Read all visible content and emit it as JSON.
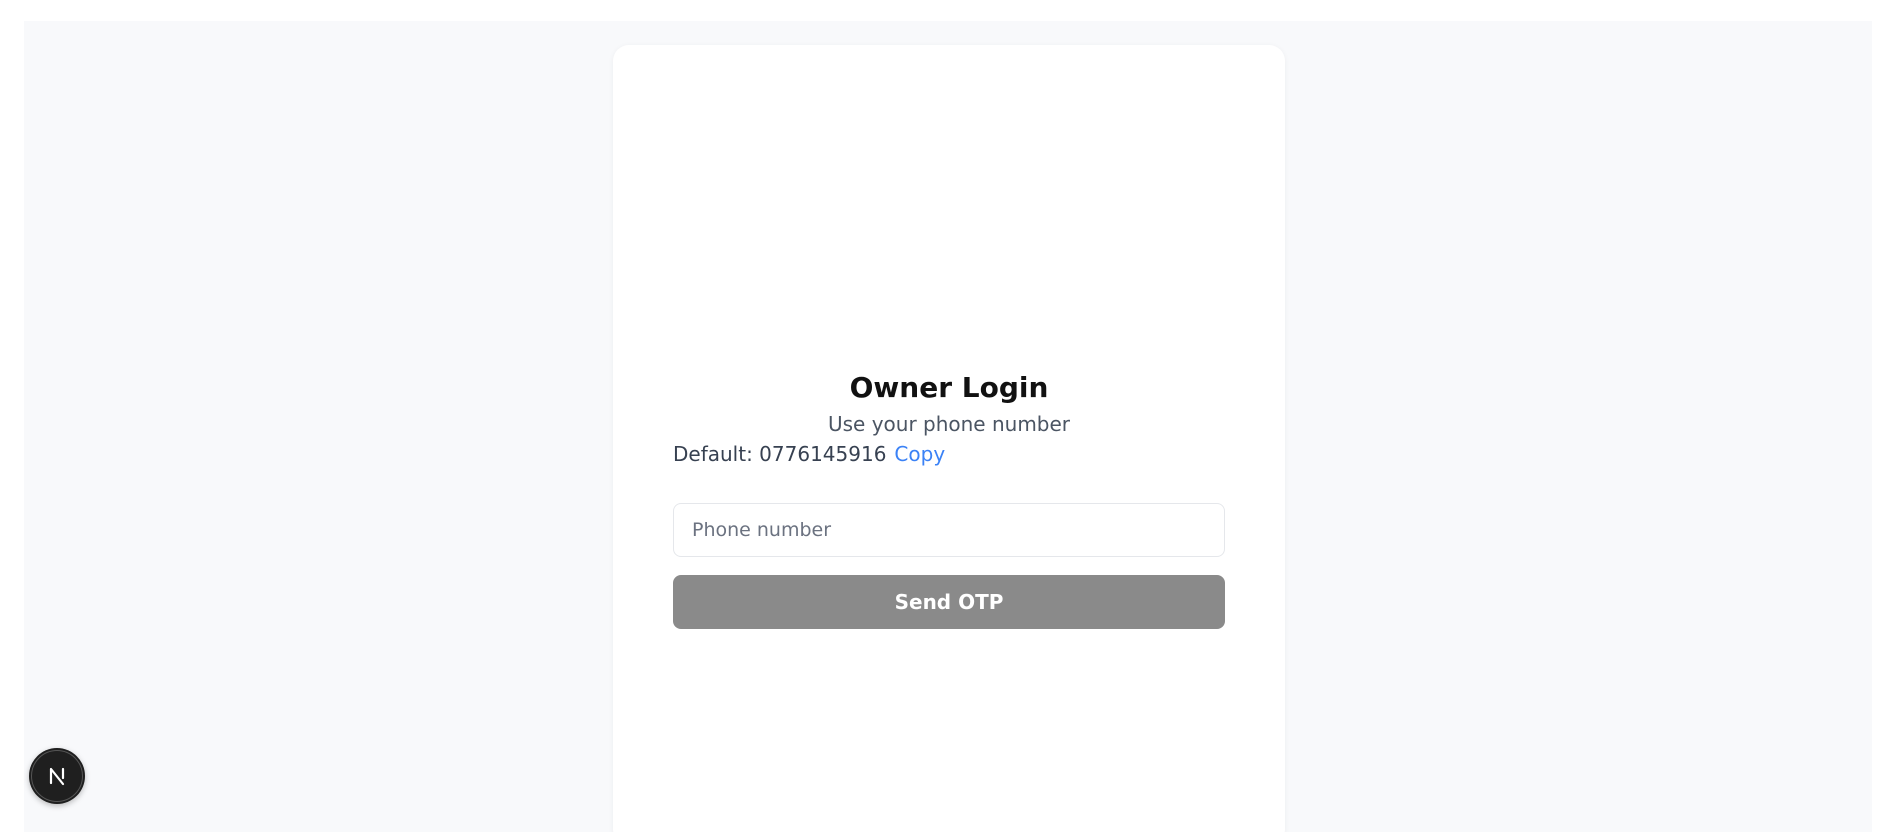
{
  "login": {
    "title": "Owner Login",
    "subtitle": "Use your phone number",
    "default_label": "Default: 0776145916",
    "copy_label": "Copy",
    "phone_placeholder": "Phone number",
    "phone_value": "",
    "send_label": "Send OTP"
  },
  "badge": {
    "icon": "nextjs-logo-icon"
  },
  "colors": {
    "link": "#3b82f6",
    "button_disabled": "#8a8a8a",
    "background": "#f8f9fb"
  }
}
